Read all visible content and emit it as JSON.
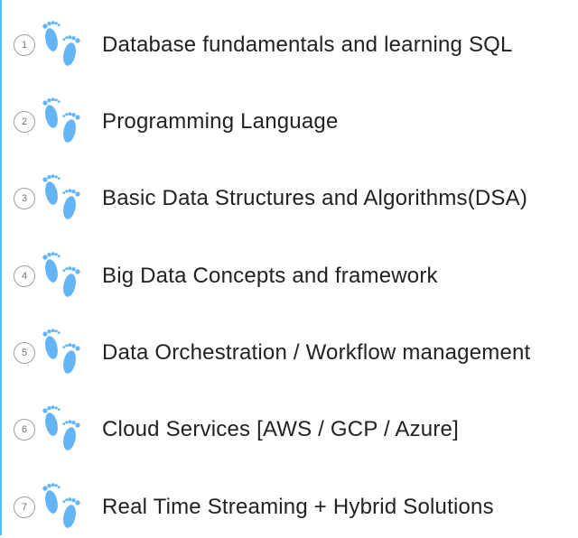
{
  "steps": [
    {
      "number": "1",
      "label": "Database fundamentals and learning SQL",
      "icon": "footprints-icon"
    },
    {
      "number": "2",
      "label": "Programming Language",
      "icon": "footprints-icon"
    },
    {
      "number": "3",
      "label": "Basic Data Structures and Algorithms(DSA)",
      "icon": "footprints-icon"
    },
    {
      "number": "4",
      "label": "Big Data Concepts and framework",
      "icon": "footprints-icon"
    },
    {
      "number": "5",
      "label": "Data Orchestration / Workflow management",
      "icon": "footprints-icon"
    },
    {
      "number": "6",
      "label": "Cloud Services [AWS / GCP / Azure]",
      "icon": "footprints-icon"
    },
    {
      "number": "7",
      "label": "Real Time Streaming + Hybrid Solutions",
      "icon": "footprints-icon"
    }
  ],
  "colors": {
    "footprint": "#64b5f6",
    "accent_border": "#4fc3f7",
    "number_circle": "#9e9e9e",
    "text": "#222222"
  }
}
